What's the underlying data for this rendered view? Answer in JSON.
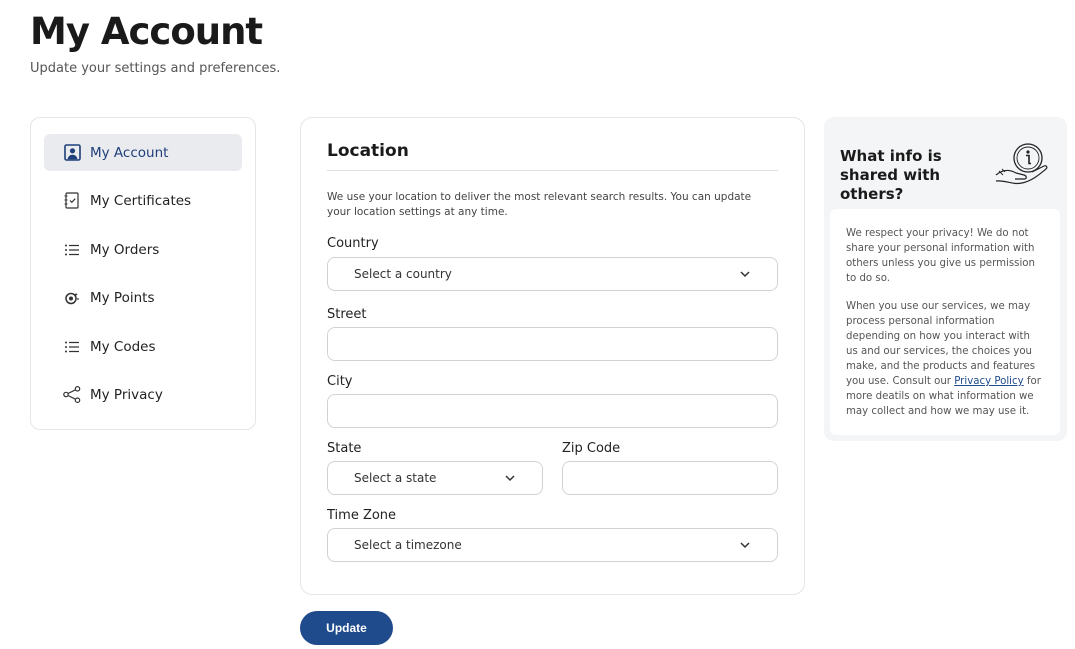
{
  "header": {
    "title": "My Account",
    "subtitle": "Update your settings and preferences."
  },
  "sidebar": {
    "items": [
      {
        "label": "My Account",
        "icon": "account-icon",
        "active": true
      },
      {
        "label": "My Certificates",
        "icon": "certificate-icon",
        "active": false
      },
      {
        "label": "My Orders",
        "icon": "list-icon",
        "active": false
      },
      {
        "label": "My Points",
        "icon": "points-icon",
        "active": false
      },
      {
        "label": "My Codes",
        "icon": "list-icon",
        "active": false
      },
      {
        "label": "My Privacy",
        "icon": "share-icon",
        "active": false
      }
    ]
  },
  "location": {
    "title": "Location",
    "description": "We use your location to deliver the most relevant search results. You can update your location settings at any time.",
    "country": {
      "label": "Country",
      "placeholder": "Select a country"
    },
    "street": {
      "label": "Street",
      "value": ""
    },
    "city": {
      "label": "City",
      "value": ""
    },
    "state": {
      "label": "State",
      "placeholder": "Select a state"
    },
    "zip": {
      "label": "Zip Code",
      "value": ""
    },
    "timezone": {
      "label": "Time Zone",
      "placeholder": "Select a timezone"
    }
  },
  "actions": {
    "update_label": "Update"
  },
  "info": {
    "title": "What info is shared with others?",
    "paragraph1": "We respect your privacy! We do not share your personal information with others unless you give us permission to do so.",
    "paragraph2_before": "When you use our services, we may process personal information depending on how you interact with us and our services, the choices you make, and the products and features you use. Consult our ",
    "link_text": "Privacy Policy",
    "paragraph2_after": " for more deatils on what information we may collect and how we may use it."
  },
  "colors": {
    "accent": "#1f4a8c",
    "active_nav_bg": "#e9ebee",
    "info_panel_bg": "#f4f5f7"
  }
}
